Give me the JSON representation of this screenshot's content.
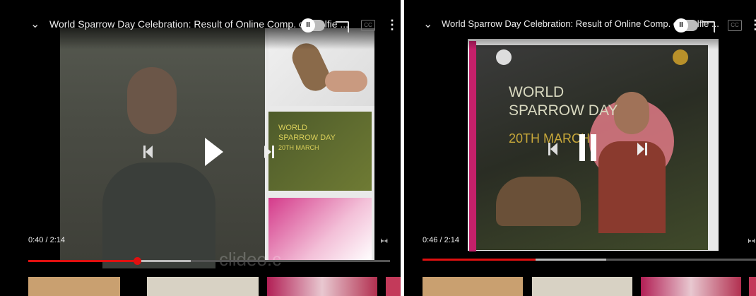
{
  "left": {
    "title": "World Sparrow Day Celebration: Result of Online Comp. on Selfie ...",
    "time": "0:40 / 2:14",
    "watermark": "clideo.c",
    "thumb_text": [
      "WORLD",
      "SPARROW DAY",
      "20TH MARCH"
    ],
    "toggle_label": "II",
    "cc_label": "CC",
    "progress": {
      "played": 0.3,
      "buffered": 0.45
    }
  },
  "right": {
    "title": "World Sparrow Day Celebration: Result of Online Comp. on Selfie ...",
    "time": "0:46 / 2:14",
    "video_text": [
      "WORLD",
      "SPARROW DAY"
    ],
    "video_date": "20TH MARCH",
    "toggle_label": "II",
    "cc_label": "CC",
    "progress": {
      "played": 0.34,
      "buffered": 0.55
    }
  },
  "colors": {
    "accent": "#e01010",
    "background": "#000000"
  }
}
